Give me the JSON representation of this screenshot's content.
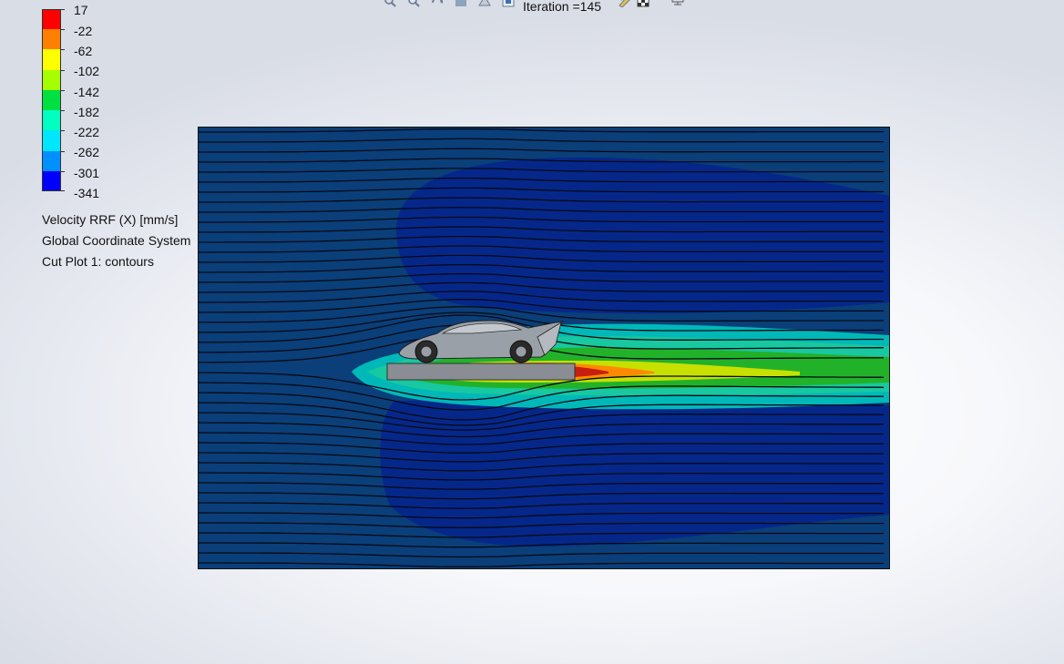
{
  "toolbar": {
    "icons": [
      "zoom-to-fit-icon",
      "zoom-in-icon",
      "rotate-icon",
      "pan-icon",
      "view-orientation-icon",
      "display-style-icon",
      "edit-appearance-icon",
      "section-view-icon",
      "monitor-icon"
    ],
    "iteration_label": "Iteration =145"
  },
  "legend": {
    "tick_labels": [
      "17",
      "-22",
      "-62",
      "-102",
      "-142",
      "-182",
      "-222",
      "-262",
      "-301",
      "-341"
    ],
    "colors": [
      "#ff0000",
      "#ff8000",
      "#ffff00",
      "#a6ff00",
      "#00e040",
      "#00ffc0",
      "#00e6ff",
      "#0090ff",
      "#0000ff"
    ]
  },
  "info": {
    "quantity": "Velocity RRF (X) [mm/s]",
    "coordinate_system": "Global Coordinate System",
    "plot_name": "Cut Plot 1: contours"
  },
  "plot": {
    "background_color": "#0a3f7a",
    "low_region_color": "#06278a",
    "streamline_count": 44
  }
}
